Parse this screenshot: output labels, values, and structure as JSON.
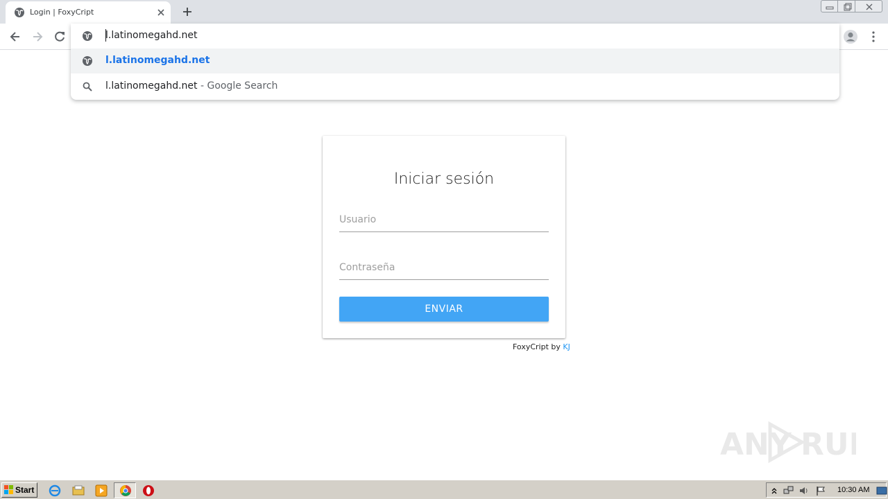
{
  "browser": {
    "tab": {
      "title": "Login | FoxyCript",
      "favicon": "globe-icon"
    },
    "omnibox": {
      "value": "l.latinomegahd.net",
      "suggestions": [
        {
          "text": "l.latinomegahd.net",
          "suffix": "",
          "icon": "globe-icon"
        },
        {
          "text": "l.latinomegahd.net",
          "suffix": " - Google Search",
          "icon": "search-icon"
        }
      ]
    }
  },
  "login": {
    "title": "Iniciar sesión",
    "username_placeholder": "Usuario",
    "password_placeholder": "Contraseña",
    "submit_label": "ENVIAR",
    "credit_prefix": "FoxyCript by ",
    "credit_link": "KJ"
  },
  "watermark": {
    "left": "ANY",
    "right": "RUN"
  },
  "taskbar": {
    "start_label": "Start",
    "apps": [
      "ie-icon",
      "explorer-icon",
      "media-player-icon",
      "chrome-icon",
      "opera-icon"
    ],
    "clock": "10:30 AM"
  },
  "colors": {
    "accent": "#42a5f5",
    "link": "#2196f3",
    "suggestion": "#1a73e8",
    "tabstrip": "#dee1e6"
  }
}
